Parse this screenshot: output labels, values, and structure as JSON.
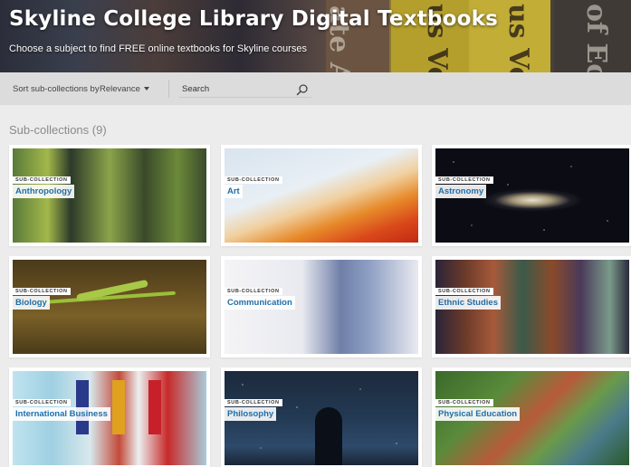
{
  "banner": {
    "title": "Skyline College Library Digital Textbooks",
    "subtitle": "Choose a subject to find FREE online textbooks for Skyline courses",
    "spine_texts": [
      "ate A",
      "us Volu",
      "us Volu",
      "of Ec"
    ]
  },
  "toolbar": {
    "sort_label": "Sort sub-collections by",
    "sort_value": "Relevance",
    "search_placeholder": "Search"
  },
  "section": {
    "heading": "Sub-collections (9)"
  },
  "tiles": [
    {
      "badge": "SUB-COLLECTION",
      "label": "Anthropology"
    },
    {
      "badge": "SUB-COLLECTION",
      "label": "Art"
    },
    {
      "badge": "SUB-COLLECTION",
      "label": "Astronomy"
    },
    {
      "badge": "SUB-COLLECTION",
      "label": "Biology"
    },
    {
      "badge": "SUB-COLLECTION",
      "label": "Communication"
    },
    {
      "badge": "SUB-COLLECTION",
      "label": "Ethnic Studies"
    },
    {
      "badge": "SUB-COLLECTION",
      "label": "International Business"
    },
    {
      "badge": "SUB-COLLECTION",
      "label": "Philosophy"
    },
    {
      "badge": "SUB-COLLECTION",
      "label": "Physical Education"
    }
  ],
  "colors": {
    "accent": "#1f6ea8",
    "toolbar_bg": "#dcdcdc",
    "page_bg": "#ececec"
  }
}
